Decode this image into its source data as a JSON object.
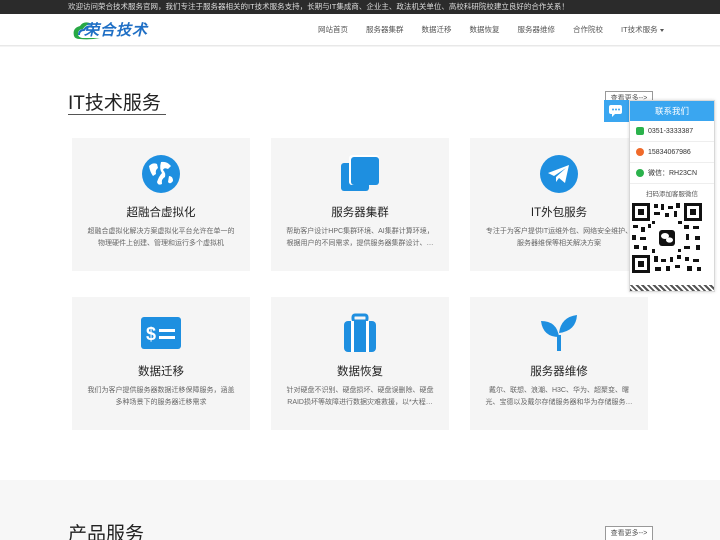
{
  "topbar": {
    "text": "欢迎访问荣合技术服务官网，我们专注于服务器相关的IT技术服务支持，长期与IT集成商、企业主、政法机关单位、高校科研院校建立良好的合作关系！"
  },
  "header": {
    "logo_text": "荣合技术",
    "nav": [
      "网站首页",
      "服务器集群",
      "数据迁移",
      "数据恢复",
      "服务器维修",
      "合作院校",
      "IT技术服务"
    ]
  },
  "section1": {
    "title": "IT技术服务",
    "more": "查看更多-->",
    "cards": [
      {
        "title": "超融合虚拟化",
        "desc": "超融合虚拟化解决方案虚拟化平台允许在单一的物理硬件上创建、管理和运行多个虚拟机",
        "icon": "globe-icon"
      },
      {
        "title": "服务器集群",
        "desc": "帮助客户设计HPC集群环境、AI集群计算环境，根据用户的不同需求，提供服务器集群设计、…",
        "icon": "stacked-squares-icon"
      },
      {
        "title": "IT外包服务",
        "desc": "专注于为客户提供IT运维外包、网络安全维护、服务器维保等相关解决方案",
        "icon": "paper-plane-icon"
      },
      {
        "title": "数据迁移",
        "desc": "我们为客户提供服务器数据迁移保障服务，涵盖多种场景下的服务器迁移需求",
        "icon": "money-card-icon"
      },
      {
        "title": "数据恢复",
        "desc": "针对硬盘不识别、硬盘损坏、硬盘误删除、硬盘RAID损坏等故障进行数据灾难救援，以*大程…",
        "icon": "suitcase-icon"
      },
      {
        "title": "服务器维修",
        "desc": "戴尔、联想、浪潮、H3C、华为、超聚变、曙光、宝德以及戴尔存储服务器和华为存储服务…",
        "icon": "sprout-icon"
      }
    ]
  },
  "section2": {
    "title": "产品服务",
    "more": "查看更多-->"
  },
  "contact": {
    "title": "联系我们",
    "phone": "0351-3333387",
    "mobile": "15834067986",
    "wechat": "微信：RH23CN",
    "qr_label": "扫码添加客服微信"
  },
  "colors": {
    "accent": "#1e8fe0",
    "contact_header": "#3aa6f0",
    "topbar": "#2b2b2b"
  }
}
